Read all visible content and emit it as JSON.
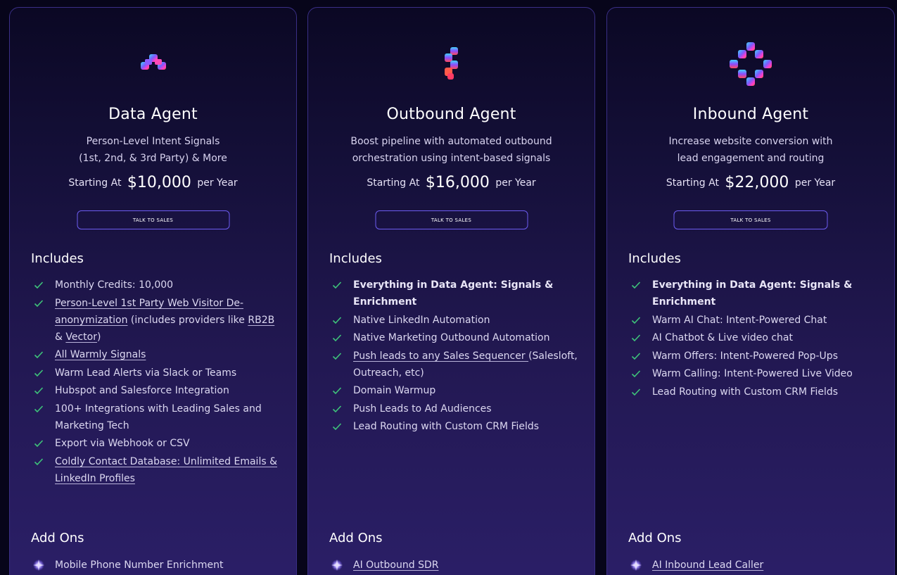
{
  "colors": {
    "accent": "#6c5cf0",
    "check": "#3ec47a",
    "background": "#07051a"
  },
  "cards": [
    {
      "logo_icon": "data-agent-logo",
      "title": "Data Agent",
      "subtitle_line1": "Person-Level Intent Signals",
      "subtitle_line2": "(1st, 2nd, & 3rd Party) & More",
      "price_prefix": "Starting At",
      "price": "$10,000",
      "price_suffix": "per Year",
      "cta": "TALK TO SALES",
      "includes_title": "Includes",
      "features": {
        "f0": "Monthly Credits: 10,000",
        "f1_link": "Person-Level 1st Party Web Visitor De-anonymization",
        "f1_text": " (includes providers like ",
        "f1_link2": "RB2B",
        "f1_text2": " & ",
        "f1_link3": "Vector",
        "f1_text3": ")",
        "f2_link": "All Warmly Signals",
        "f3": "Warm Lead Alerts via Slack or Teams",
        "f4": "Hubspot and Salesforce Integration",
        "f5": "100+ Integrations with Leading Sales and Marketing Tech",
        "f6": "Export via Webhook or CSV",
        "f7_link": "Coldly Contact Database: Unlimited Emails & LinkedIn Profiles"
      },
      "addons_title": "Add Ons",
      "addon": "Mobile Phone Number Enrichment"
    },
    {
      "logo_icon": "outbound-agent-logo",
      "title": "Outbound Agent",
      "subtitle_line1": "Boost pipeline with automated outbound",
      "subtitle_line2": "orchestration using intent-based signals",
      "price_prefix": "Starting At",
      "price": "$16,000",
      "price_suffix": "per Year",
      "cta": "TALK TO SALES",
      "includes_title": "Includes",
      "features": {
        "f0_bold": "Everything in Data Agent: Signals & Enrichment",
        "f1": "Native LinkedIn Automation",
        "f2": "Native Marketing Outbound Automation",
        "f3_link": "Push leads to any Sales Sequencer ",
        "f3_text": "(Salesloft, Outreach, etc)",
        "f4": "Domain Warmup",
        "f5": "Push Leads to Ad Audiences",
        "f6": "Lead Routing with Custom CRM Fields"
      },
      "addons_title": "Add Ons",
      "addon": "AI Outbound SDR"
    },
    {
      "logo_icon": "inbound-agent-logo",
      "title": "Inbound Agent",
      "subtitle_line1": "Increase website conversion with",
      "subtitle_line2": "lead engagement and routing",
      "price_prefix": "Starting At",
      "price": "$22,000",
      "price_suffix": "per Year",
      "cta": "TALK TO SALES",
      "includes_title": "Includes",
      "features": {
        "f0_bold": "Everything in Data Agent: Signals & Enrichment",
        "f1": "Warm AI Chat: Intent-Powered Chat",
        "f2": "AI Chatbot & Live video chat",
        "f3": "Warm Offers: Intent-Powered Pop-Ups",
        "f4": "Warm Calling: Intent-Powered Live Video",
        "f5": "Lead Routing with Custom CRM Fields"
      },
      "addons_title": "Add Ons",
      "addon": "AI Inbound Lead Caller"
    }
  ]
}
